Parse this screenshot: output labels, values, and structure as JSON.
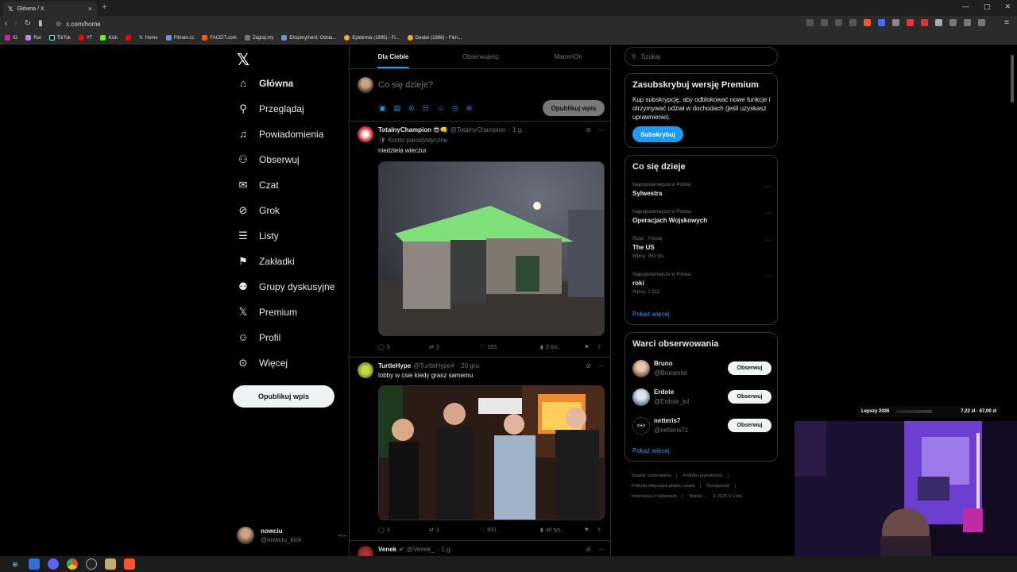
{
  "browser": {
    "tab_title": "Główna / X",
    "url": "x.com/home",
    "bookmarks": [
      "IG",
      "Rat",
      "TikTok",
      "YT",
      "Kick",
      "",
      "Home",
      "Filman.cc",
      "FACEIT.com",
      "Zagraj.my",
      "Eksperyment: Odsia...",
      "Epidemia (1995) - Fi...",
      "Dealer (1996) - Film..."
    ]
  },
  "nav": {
    "items": [
      {
        "label": "Główna",
        "icon": "home-icon"
      },
      {
        "label": "Przeglądaj",
        "icon": "search-icon"
      },
      {
        "label": "Powiadomienia",
        "icon": "bell-icon"
      },
      {
        "label": "Obserwuj",
        "icon": "follow-icon"
      },
      {
        "label": "Czat",
        "icon": "mail-icon"
      },
      {
        "label": "Grok",
        "icon": "grok-icon"
      },
      {
        "label": "Listy",
        "icon": "list-icon"
      },
      {
        "label": "Zakładki",
        "icon": "bookmark-icon"
      },
      {
        "label": "Grupy dyskusyjne",
        "icon": "people-icon"
      },
      {
        "label": "Premium",
        "icon": "x-icon"
      },
      {
        "label": "Profil",
        "icon": "profile-icon"
      },
      {
        "label": "Więcej",
        "icon": "more-icon"
      }
    ],
    "post_button": "Opublikuj wpis",
    "account": {
      "name": "nowciu",
      "handle": "@nowciu_kick"
    }
  },
  "feed": {
    "tabs": [
      "Dla Ciebie",
      "Obserwujesz",
      "MammOn"
    ],
    "composer": {
      "placeholder": "Co się dzieje?",
      "button": "Opublikuj wpis"
    },
    "tweets": [
      {
        "name": "TotalnyChampion 😎👊",
        "handle": "@TotalnyChampion",
        "time": "1 g.",
        "badge": "🛡 Konto parodystyczne",
        "text": "niedziela wieczur",
        "replies": "5",
        "reposts": "3",
        "likes": "165",
        "views": "3 tys."
      },
      {
        "name": "TurtleHype",
        "handle": "@TurtleHype4",
        "time": "20 gru",
        "text": "lobby w csie kiedy grasz samemu",
        "replies": "3",
        "reposts": "3",
        "likes": "931",
        "views": "40 tys."
      },
      {
        "name": "Venek",
        "handle": "@Venek_",
        "time": "1 g."
      }
    ]
  },
  "sidebar": {
    "search_placeholder": "Szukaj",
    "premium": {
      "title": "Zasubskrybuj wersję Premium",
      "text": "Kup subskrypcję, aby odblokować nowe funkcje i otrzymywać udział w dochodach (jeśli uzyskasz uprawnienie).",
      "button": "Subskrybuj"
    },
    "trends": {
      "title": "Co się dzieje",
      "items": [
        {
          "category": "Najpopularniejsze w Polska",
          "topic": "Sylwestra",
          "posts": ""
        },
        {
          "category": "Najpopularniejsze w Polska",
          "topic": "Operacjach Wojskowych",
          "posts": ""
        },
        {
          "category": "Rząd · Trendy",
          "topic": "The US",
          "posts": "Wpisy: 951 tys."
        },
        {
          "category": "Najpopularniejsze w Polska",
          "topic": "roki",
          "posts": "Wpisy: 2 112"
        }
      ],
      "show_more": "Pokaż więcej"
    },
    "who_to_follow": {
      "title": "Warci obserwowania",
      "items": [
        {
          "name": "Bruno",
          "handle": "@Bruneslol",
          "button": "Obserwuj"
        },
        {
          "name": "Erdote",
          "handle": "@Erdote_lol",
          "button": "Obserwuj"
        },
        {
          "name": "netteris7",
          "handle": "@netteris71",
          "button": "Obserwuj"
        }
      ],
      "show_more": "Pokaż więcej"
    },
    "footer": [
      "Zasady użytkowania",
      "Polityka prywatności",
      "Polityka dotycząca plików cookie",
      "Dostępność",
      "Informacja o reklamach",
      "Więcej ...",
      "© 2025 X Corp."
    ]
  },
  "overlay": {
    "label": "Lepszy 2026",
    "price": "7,22 zł · 67,00 zł"
  },
  "colors": {
    "accent": "#1d9bf0",
    "background": "#000000",
    "border": "#2f3336",
    "muted": "#71767b"
  }
}
